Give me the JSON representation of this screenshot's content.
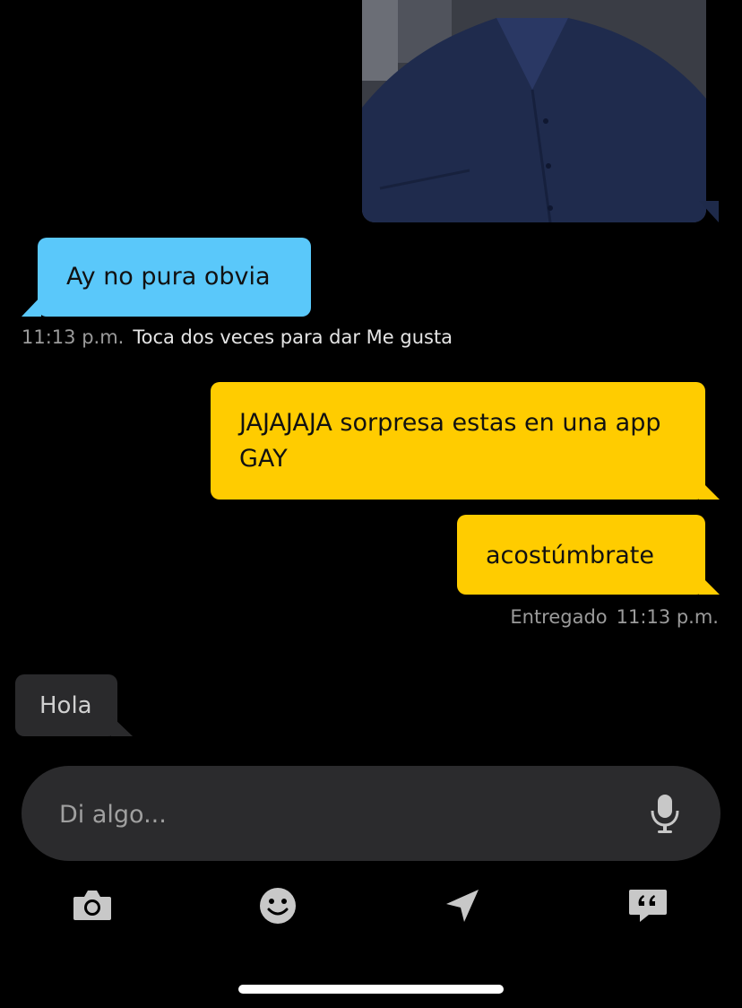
{
  "colors": {
    "background": "#000000",
    "received_bubble": "#5ac8fa",
    "sent_bubble": "#ffcc00",
    "typing_bubble": "#2a2a2c",
    "input_bar": "#2b2b2d",
    "meta_text": "#9b9b9b",
    "icon": "#c8c8c8"
  },
  "messages": {
    "received_1": {
      "text": "Ay no pura obvia"
    },
    "received_meta": {
      "time": "11:13 p.m.",
      "hint": "Toca dos veces para dar Me gusta"
    },
    "sent_1": {
      "text": "JAJAJAJA sorpresa estas en una app GAY"
    },
    "sent_2": {
      "text": "acostúmbrate"
    },
    "sent_meta": {
      "status": "Entregado",
      "time": "11:13 p.m."
    },
    "typing": {
      "text": "Hola"
    }
  },
  "composer": {
    "placeholder": "Di algo...",
    "mic_icon": "microphone-icon"
  },
  "toolbar": {
    "icons": [
      "camera-icon",
      "emoji-icon",
      "location-arrow-icon",
      "saved-phrases-icon"
    ]
  }
}
